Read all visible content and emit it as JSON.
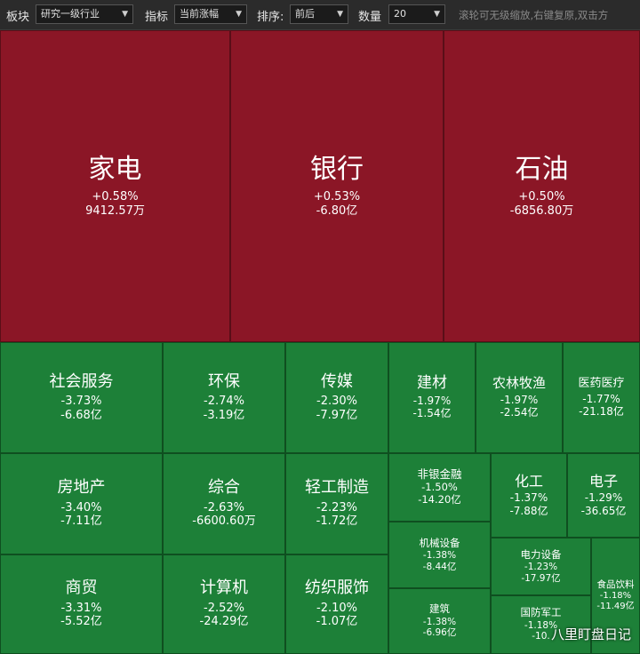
{
  "toolbar": {
    "sector_label": "板块",
    "sector_value": "研究一级行业",
    "metric_label": "指标",
    "metric_value": "当前涨幅",
    "sort_label": "排序:",
    "sort_value": "前后",
    "count_label": "数量",
    "count_value": "20",
    "hint": "滚轮可无级缩放,右键复原,双击方"
  },
  "tiles": [
    {
      "name": "家电",
      "change": "+0.58%",
      "flow": "9412.57万",
      "color": "red"
    },
    {
      "name": "银行",
      "change": "+0.53%",
      "flow": "-6.80亿",
      "color": "red"
    },
    {
      "name": "石油",
      "change": "+0.50%",
      "flow": "-6856.80万",
      "color": "red"
    },
    {
      "name": "社会服务",
      "change": "-3.73%",
      "flow": "-6.68亿",
      "color": "green"
    },
    {
      "name": "环保",
      "change": "-2.74%",
      "flow": "-3.19亿",
      "color": "green"
    },
    {
      "name": "传媒",
      "change": "-2.30%",
      "flow": "-7.97亿",
      "color": "green"
    },
    {
      "name": "建材",
      "change": "-1.97%",
      "flow": "-1.54亿",
      "color": "green"
    },
    {
      "name": "农林牧渔",
      "change": "-1.97%",
      "flow": "-2.54亿",
      "color": "green"
    },
    {
      "name": "医药医疗",
      "change": "-1.77%",
      "flow": "-21.18亿",
      "color": "green"
    },
    {
      "name": "房地产",
      "change": "-3.40%",
      "flow": "-7.11亿",
      "color": "green"
    },
    {
      "name": "综合",
      "change": "-2.63%",
      "flow": "-6600.60万",
      "color": "green"
    },
    {
      "name": "轻工制造",
      "change": "-2.23%",
      "flow": "-1.72亿",
      "color": "green"
    },
    {
      "name": "非银金融",
      "change": "-1.50%",
      "flow": "-14.20亿",
      "color": "green"
    },
    {
      "name": "化工",
      "change": "-1.37%",
      "flow": "-7.88亿",
      "color": "green"
    },
    {
      "name": "电子",
      "change": "-1.29%",
      "flow": "-36.65亿",
      "color": "green"
    },
    {
      "name": "商贸",
      "change": "-3.31%",
      "flow": "-5.52亿",
      "color": "green"
    },
    {
      "name": "计算机",
      "change": "-2.52%",
      "flow": "-24.29亿",
      "color": "green"
    },
    {
      "name": "纺织服饰",
      "change": "-2.10%",
      "flow": "-1.07亿",
      "color": "green"
    },
    {
      "name": "机械设备",
      "change": "-1.38%",
      "flow": "-8.44亿",
      "color": "green"
    },
    {
      "name": "电力设备",
      "change": "-1.23%",
      "flow": "-17.97亿",
      "color": "green"
    },
    {
      "name": "食品饮料",
      "change": "-1.18%",
      "flow": "-11.49亿",
      "color": "green"
    },
    {
      "name": "建筑",
      "change": "-1.38%",
      "flow": "-6.96亿",
      "color": "green"
    },
    {
      "name": "国防军工",
      "change": "-1.18%",
      "flow": "-10.",
      "color": "green"
    }
  ],
  "watermark": "八里盯盘日记",
  "colors": {
    "up": "#8b1626",
    "down": "#1d8038",
    "toolbar": "#2b2b2b"
  }
}
